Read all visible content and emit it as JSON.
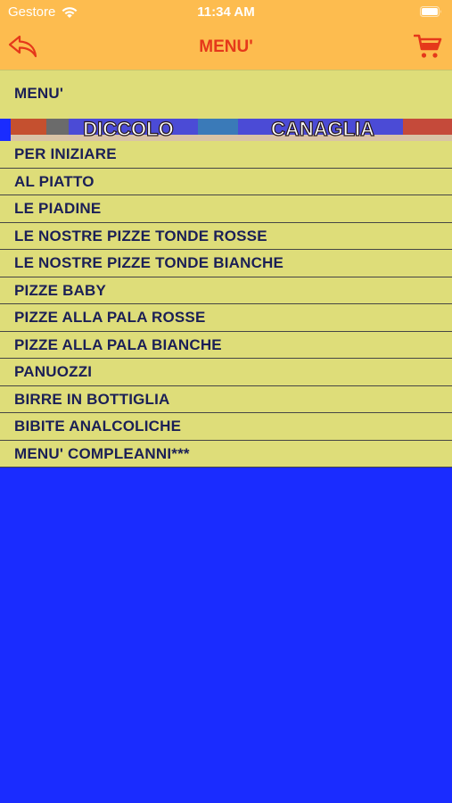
{
  "status_bar": {
    "carrier": "Gestore",
    "time": "11:34 AM"
  },
  "navbar": {
    "title": "MENU'"
  },
  "section": {
    "title": "MENU'"
  },
  "banner": {
    "text": "PICCOLO CANAGLIA"
  },
  "menu_items": [
    "PER INIZIARE",
    "AL PIATTO",
    "LE PIADINE",
    "LE NOSTRE PIZZE TONDE ROSSE",
    "LE NOSTRE PIZZE TONDE BIANCHE",
    "PIZZE BABY",
    "PIZZE ALLA PALA ROSSE",
    "PIZZE ALLA PALA BIANCHE",
    "PANUOZZI",
    "BIRRE IN BOTTIGLIA",
    "BIBITE ANALCOLICHE",
    "MENU' COMPLEANNI***"
  ],
  "colors": {
    "top_bar": "#fdbc4f",
    "title": "#e5381a",
    "list_bg": "#dedd79",
    "list_text": "#1b1f56",
    "page_bg": "#1a2cff"
  }
}
